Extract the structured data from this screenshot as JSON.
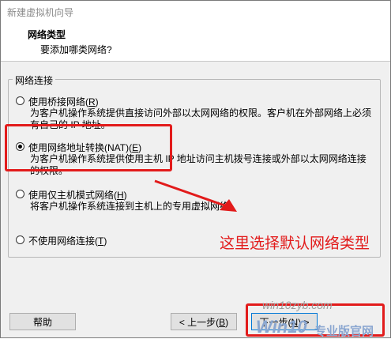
{
  "window": {
    "title": "新建虚拟机向导"
  },
  "header": {
    "title": "网络类型",
    "subtitle": "要添加哪类网络?"
  },
  "group": {
    "legend": "网络连接"
  },
  "options": [
    {
      "label": "使用桥接网络(",
      "key": "R",
      "tail": ")",
      "desc": "为客户机操作系统提供直接访问外部以太网网络的权限。客户机在外部网络上必须有自己的 IP 地址。",
      "selected": false
    },
    {
      "label": "使用网络地址转换(NAT)(",
      "key": "E",
      "tail": ")",
      "desc": "为客户机操作系统提供使用主机 IP 地址访问主机拨号连接或外部以太网网络连接的权限。",
      "selected": true
    },
    {
      "label": "使用仅主机模式网络(",
      "key": "H",
      "tail": ")",
      "desc": "将客户机操作系统连接到主机上的专用虚拟网络。",
      "selected": false
    },
    {
      "label": "不使用网络连接(",
      "key": "T",
      "tail": ")",
      "desc": "",
      "selected": false
    }
  ],
  "buttons": {
    "help": "帮助",
    "back_label": "< 上一步(",
    "back_key": "B",
    "back_tail": ")",
    "next_label": "下一步(",
    "next_key": "N",
    "next_tail": ") >"
  },
  "annotation": {
    "text": "这里选择默认网络类型",
    "color": "#e21b1b"
  },
  "watermark": {
    "url": "win10zyb.com",
    "brand": "Win10",
    "brand_tail": "专业版官网"
  }
}
